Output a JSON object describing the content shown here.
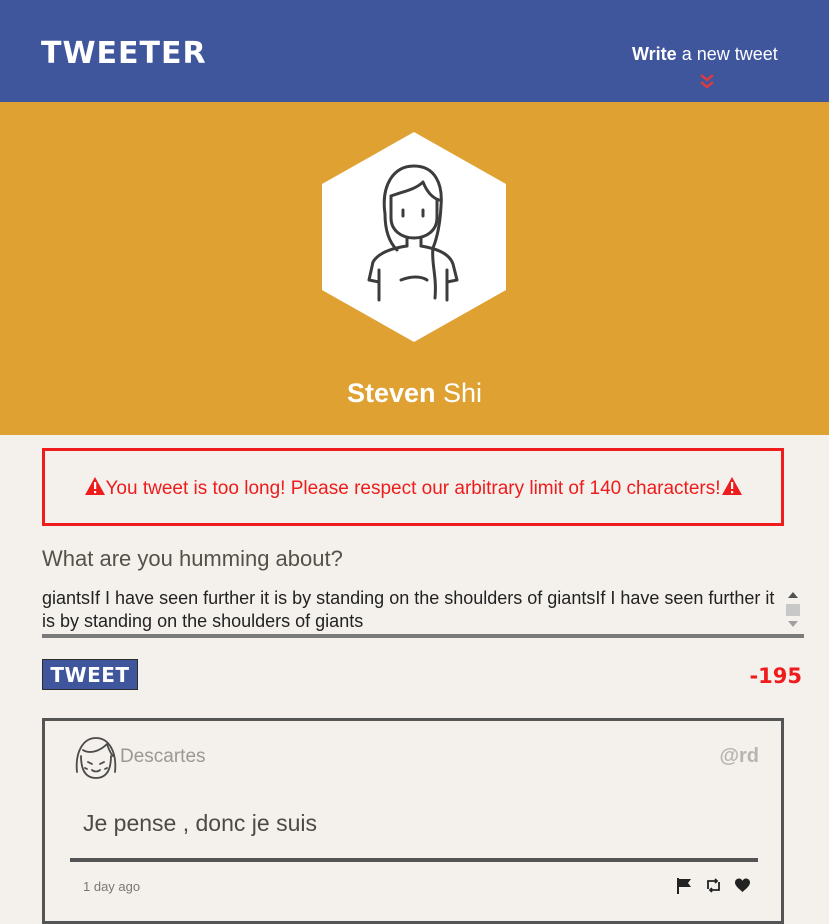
{
  "nav": {
    "logo": "TWEETER",
    "compose_bold": "Write",
    "compose_rest": " a new tweet"
  },
  "profile": {
    "first_name": "Steven",
    "last_name": " Shi"
  },
  "error": {
    "message": "You tweet is too long! Please respect our arbitrary limit of 140 characters!"
  },
  "compose": {
    "prompt": "What are you humming about?",
    "text": "giantsIf I have seen further it is by standing on the shoulders of giantsIf I have seen further it is by standing on the shoulders of giants",
    "button_label": "TWEET",
    "counter": "-195"
  },
  "tweets": [
    {
      "name": "Descartes",
      "handle": "@rd",
      "content": "Je pense , donc je suis",
      "time": "1 day ago",
      "actions": [
        "flag-icon",
        "retweet-icon",
        "heart-icon"
      ]
    }
  ],
  "colors": {
    "nav": "#3f569d",
    "banner": "#dea132",
    "error": "#ee1c1c",
    "background": "#f4f1ec"
  }
}
